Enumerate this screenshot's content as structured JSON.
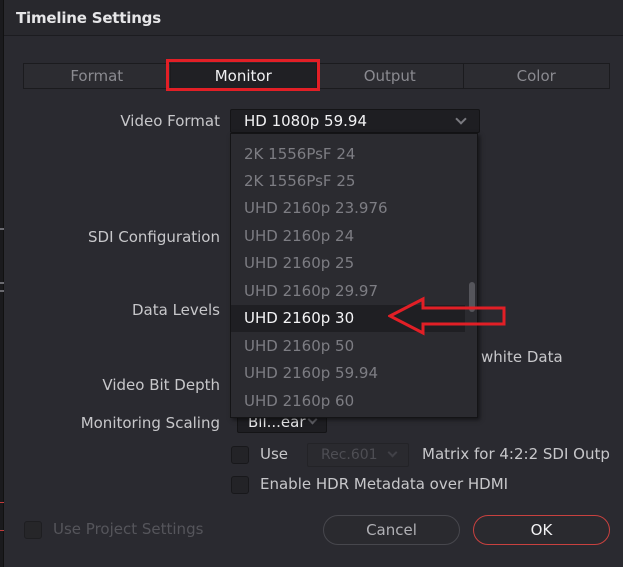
{
  "dialog": {
    "title": "Timeline Settings"
  },
  "tabs": [
    {
      "label": "Format",
      "active": false
    },
    {
      "label": "Monitor",
      "active": true
    },
    {
      "label": "Output",
      "active": false
    },
    {
      "label": "Color",
      "active": false
    }
  ],
  "fields": {
    "video_format_label": "Video Format",
    "video_format_value": "HD 1080p 59.94",
    "sdi_configuration_label": "SDI Configuration",
    "data_levels_label": "Data Levels",
    "data_levels_option_partial": "white Data",
    "video_bit_depth_label": "Video Bit Depth",
    "monitoring_scaling_label": "Monitoring Scaling",
    "monitoring_scaling_value": "Bil...ear"
  },
  "video_format_dropdown": {
    "items": [
      "2K 1556PsF 24",
      "2K 1556PsF 25",
      "UHD 2160p 23.976",
      "UHD 2160p 24",
      "UHD 2160p 25",
      "UHD 2160p 29.97",
      "UHD 2160p 30",
      "UHD 2160p 50",
      "UHD 2160p 59.94",
      "UHD 2160p 60"
    ],
    "highlighted": "UHD 2160p 30"
  },
  "options": {
    "use_label": "Use",
    "matrix_value": "Rec.601",
    "matrix_suffix": "Matrix for 4:2:2 SDI Outp",
    "use_checked": false,
    "hdr_label": "Enable HDR Metadata over HDMI",
    "hdr_checked": false
  },
  "footer": {
    "use_project_settings_label": "Use Project Settings",
    "use_project_settings_checked": false,
    "cancel_label": "Cancel",
    "ok_label": "OK"
  },
  "annotations": {
    "highlight_color": "#e21f26"
  }
}
